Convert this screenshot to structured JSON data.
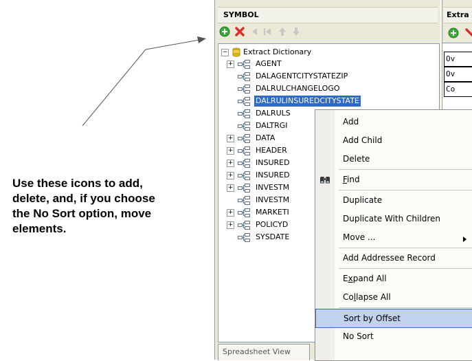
{
  "callout": {
    "text": "Use these icons to add,\ndelete, and, if you choose\nthe No Sort option, move\nelements."
  },
  "symbol_panel": {
    "title": "SYMBOL",
    "toolbar": [
      "add-icon",
      "delete-icon",
      "move-left-icon",
      "move-first-icon",
      "move-up-icon",
      "move-down-icon"
    ],
    "tree": {
      "root": "Extract Dictionary",
      "items": [
        {
          "label": "AGENT",
          "expandable": true
        },
        {
          "label": "DALAGENTCITYSTATEZIP",
          "expandable": false
        },
        {
          "label": "DALRULCHANGELOGO",
          "expandable": false
        },
        {
          "label": "DALRULINSUREDCITYSTATE",
          "expandable": false,
          "selected": true
        },
        {
          "label": "DALRULS",
          "expandable": false
        },
        {
          "label": "DALTRGI",
          "expandable": false
        },
        {
          "label": "DATA",
          "expandable": true
        },
        {
          "label": "HEADER",
          "expandable": true
        },
        {
          "label": "INSURED",
          "expandable": true
        },
        {
          "label": "INSURED",
          "expandable": true
        },
        {
          "label": "INVESTM",
          "expandable": true
        },
        {
          "label": "INVESTM",
          "expandable": false
        },
        {
          "label": "MARKETI",
          "expandable": true
        },
        {
          "label": "POLICYD",
          "expandable": true
        },
        {
          "label": "SYSDATE",
          "expandable": false
        }
      ]
    },
    "bottom_tab": "Spreadsheet View"
  },
  "right_panel": {
    "title": "Extra",
    "cells": [
      "Ov",
      "Ov",
      "Co"
    ]
  },
  "context_menu": {
    "items": [
      {
        "label": "Add"
      },
      {
        "label": "Add Child"
      },
      {
        "label": "Delete"
      },
      {
        "label": "Find",
        "icon": "binoculars-icon",
        "separator_before": true
      },
      {
        "label": "Duplicate",
        "separator_before": true
      },
      {
        "label": "Duplicate With Children"
      },
      {
        "label": "Move ...",
        "submenu": true
      },
      {
        "label": "Add Addressee Record",
        "separator_before": true
      },
      {
        "label": "Expand All",
        "separator_before": true
      },
      {
        "label": "Collapse All"
      },
      {
        "label": "Sort by Offset",
        "separator_before": true,
        "highlighted": true
      },
      {
        "label": "No Sort"
      }
    ]
  },
  "colors": {
    "selection": "#316ac5",
    "menu_highlight": "#c1d2ee",
    "panel_bg": "#ece9d8"
  }
}
